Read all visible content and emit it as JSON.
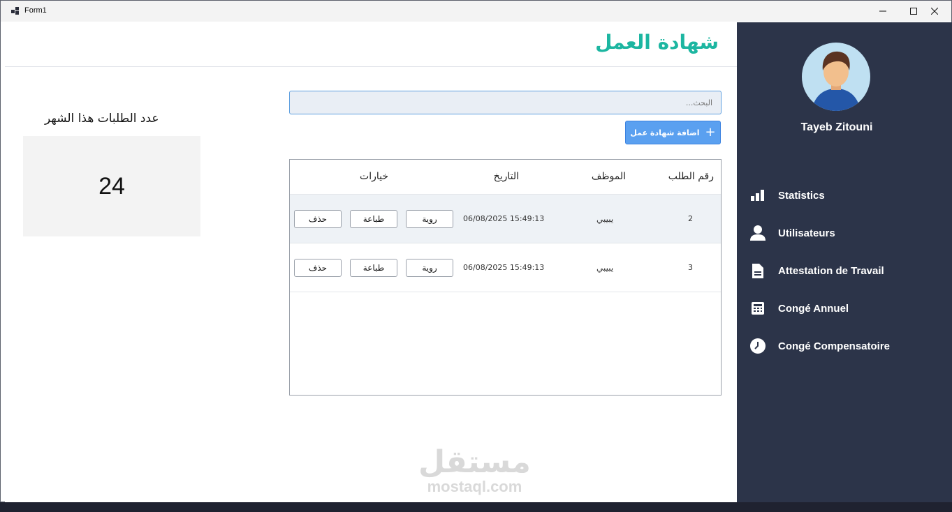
{
  "window": {
    "title": "Form1"
  },
  "header": {
    "title": "شهادة العمل"
  },
  "search": {
    "placeholder": "البحث..."
  },
  "toolbar": {
    "add_label": "اضافة شهادة عمل"
  },
  "table": {
    "columns": [
      "رقم الطلب",
      "الموظف",
      "التاريخ",
      "خيارات"
    ],
    "rows": [
      {
        "id": "2",
        "employee": "يبيبي",
        "date": "06/08/2025 15:49:13"
      },
      {
        "id": "3",
        "employee": "يبيبي",
        "date": "06/08/2025 15:49:13"
      }
    ],
    "actions": {
      "view": "روية",
      "print": "طباعة",
      "delete": "حذف"
    }
  },
  "stats": {
    "label": "عدد الطلبات هذا الشهر",
    "value": "24"
  },
  "watermark": {
    "arabic": "مستقل",
    "latin": "mostaql.com"
  },
  "sidebar": {
    "username": "Tayeb Zitouni",
    "items": [
      {
        "label": "Statistics",
        "icon": "bar-chart-icon"
      },
      {
        "label": "Utilisateurs",
        "icon": "user-icon"
      },
      {
        "label": "Attestation de Travail",
        "icon": "document-icon"
      },
      {
        "label": "Congé Annuel",
        "icon": "calculator-icon"
      },
      {
        "label": "Congé Compensatoire",
        "icon": "clock-icon"
      }
    ]
  },
  "colors": {
    "accent": "#1cb6a1",
    "primary_button": "#5aa0f0",
    "sidebar": "#2c3449"
  }
}
